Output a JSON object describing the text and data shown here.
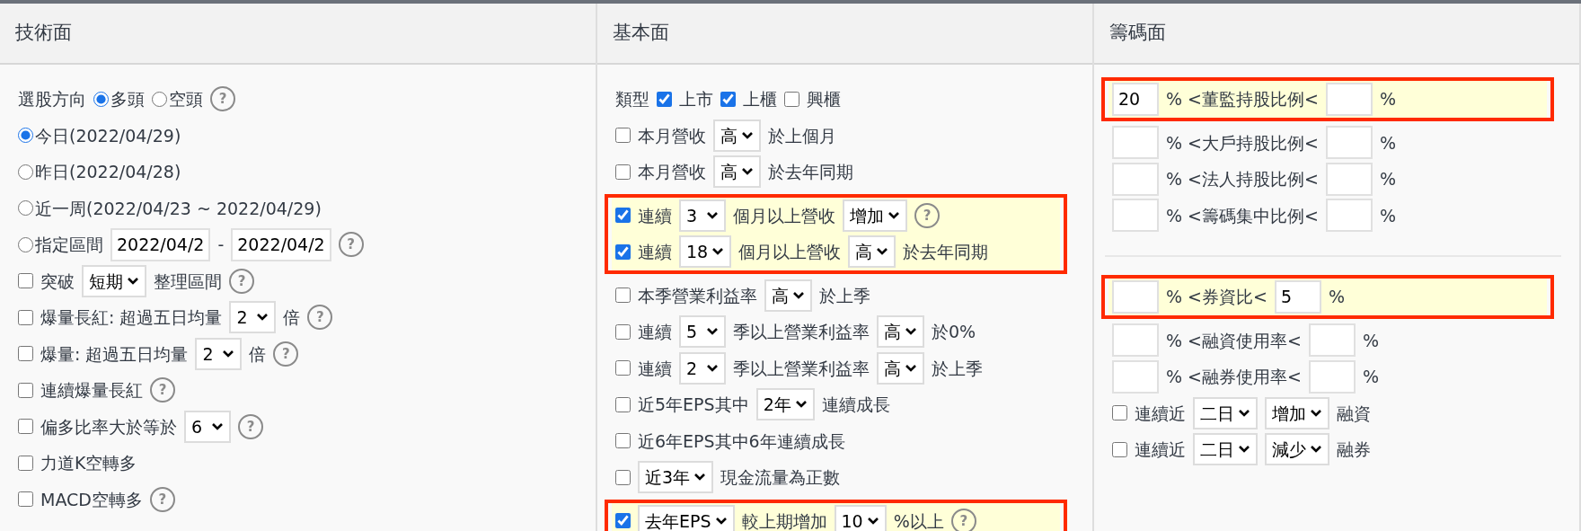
{
  "columns": [
    {
      "title": "技術面",
      "sections": [
        [
          {
            "highlighted": false,
            "rows": [
              {
                "items": [
                  {
                    "kind": "text",
                    "text": "選股方向"
                  },
                  {
                    "kind": "radio",
                    "label": "多頭",
                    "selected": true
                  },
                  {
                    "kind": "radio",
                    "label": "空頭",
                    "selected": false
                  },
                  {
                    "kind": "help",
                    "label": "?"
                  }
                ]
              },
              {
                "items": [
                  {
                    "kind": "radio",
                    "label": "今日(2022/04/29)",
                    "selected": true
                  }
                ]
              },
              {
                "items": [
                  {
                    "kind": "radio",
                    "label": "昨日(2022/04/28)",
                    "selected": false
                  }
                ]
              },
              {
                "items": [
                  {
                    "kind": "radio",
                    "label": "近一周(2022/04/23 ~ 2022/04/29)",
                    "selected": false
                  }
                ]
              },
              {
                "items": [
                  {
                    "kind": "radio",
                    "label": "指定區間",
                    "selected": false
                  },
                  {
                    "kind": "input",
                    "value": "2022/04/2"
                  },
                  {
                    "kind": "text",
                    "text": "-"
                  },
                  {
                    "kind": "input",
                    "value": "2022/04/2"
                  },
                  {
                    "kind": "help",
                    "label": "?"
                  }
                ]
              },
              {
                "items": [
                  {
                    "kind": "checkbox",
                    "checked": false
                  },
                  {
                    "kind": "text",
                    "text": "突破"
                  },
                  {
                    "kind": "select",
                    "value": "短期"
                  },
                  {
                    "kind": "text",
                    "text": "整理區間"
                  },
                  {
                    "kind": "help",
                    "label": "?"
                  }
                ]
              },
              {
                "items": [
                  {
                    "kind": "checkbox",
                    "checked": false
                  },
                  {
                    "kind": "text",
                    "text": "爆量長紅: 超過五日均量"
                  },
                  {
                    "kind": "select",
                    "value": "2"
                  },
                  {
                    "kind": "text",
                    "text": "倍"
                  },
                  {
                    "kind": "help",
                    "label": "?"
                  }
                ]
              },
              {
                "items": [
                  {
                    "kind": "checkbox",
                    "checked": false
                  },
                  {
                    "kind": "text",
                    "text": "爆量: 超過五日均量"
                  },
                  {
                    "kind": "select",
                    "value": "2"
                  },
                  {
                    "kind": "text",
                    "text": "倍"
                  },
                  {
                    "kind": "help",
                    "label": "?"
                  }
                ]
              },
              {
                "items": [
                  {
                    "kind": "checkbox",
                    "checked": false
                  },
                  {
                    "kind": "text",
                    "text": "連續爆量長紅"
                  },
                  {
                    "kind": "help",
                    "label": "?"
                  }
                ]
              },
              {
                "items": [
                  {
                    "kind": "checkbox",
                    "checked": false
                  },
                  {
                    "kind": "text",
                    "text": "偏多比率大於等於"
                  },
                  {
                    "kind": "select",
                    "value": "6"
                  },
                  {
                    "kind": "help",
                    "label": "?"
                  }
                ]
              },
              {
                "items": [
                  {
                    "kind": "checkbox",
                    "checked": false
                  },
                  {
                    "kind": "text",
                    "text": "力道K空轉多"
                  }
                ]
              },
              {
                "items": [
                  {
                    "kind": "checkbox",
                    "checked": false
                  },
                  {
                    "kind": "text",
                    "text": "MACD空轉多"
                  },
                  {
                    "kind": "help",
                    "label": "?"
                  }
                ]
              }
            ]
          }
        ]
      ]
    },
    {
      "title": "基本面",
      "sections": [
        [
          {
            "highlighted": false,
            "rows": [
              {
                "items": [
                  {
                    "kind": "text",
                    "text": "類型"
                  },
                  {
                    "kind": "checkbox",
                    "checked": true
                  },
                  {
                    "kind": "text",
                    "text": "上市"
                  },
                  {
                    "kind": "checkbox",
                    "checked": true
                  },
                  {
                    "kind": "text",
                    "text": "上櫃"
                  },
                  {
                    "kind": "checkbox",
                    "checked": false
                  },
                  {
                    "kind": "text",
                    "text": "興櫃"
                  }
                ]
              },
              {
                "items": [
                  {
                    "kind": "checkbox",
                    "checked": false
                  },
                  {
                    "kind": "text",
                    "text": "本月營收"
                  },
                  {
                    "kind": "select",
                    "value": "高"
                  },
                  {
                    "kind": "text",
                    "text": "於上個月"
                  }
                ]
              },
              {
                "items": [
                  {
                    "kind": "checkbox",
                    "checked": false
                  },
                  {
                    "kind": "text",
                    "text": "本月營收"
                  },
                  {
                    "kind": "select",
                    "value": "高"
                  },
                  {
                    "kind": "text",
                    "text": "於去年同期"
                  }
                ]
              }
            ]
          },
          {
            "highlighted": true,
            "rows": [
              {
                "items": [
                  {
                    "kind": "checkbox",
                    "checked": true
                  },
                  {
                    "kind": "text",
                    "text": "連續"
                  },
                  {
                    "kind": "select",
                    "value": "3"
                  },
                  {
                    "kind": "text",
                    "text": "個月以上營收"
                  },
                  {
                    "kind": "select",
                    "value": "增加"
                  },
                  {
                    "kind": "help",
                    "label": "?"
                  }
                ]
              },
              {
                "items": [
                  {
                    "kind": "checkbox",
                    "checked": true
                  },
                  {
                    "kind": "text",
                    "text": "連續"
                  },
                  {
                    "kind": "select",
                    "value": "18"
                  },
                  {
                    "kind": "text",
                    "text": "個月以上營收"
                  },
                  {
                    "kind": "select",
                    "value": "高"
                  },
                  {
                    "kind": "text",
                    "text": "於去年同期"
                  }
                ]
              }
            ]
          },
          {
            "highlighted": false,
            "rows": [
              {
                "items": [
                  {
                    "kind": "checkbox",
                    "checked": false
                  },
                  {
                    "kind": "text",
                    "text": "本季營業利益率"
                  },
                  {
                    "kind": "select",
                    "value": "高"
                  },
                  {
                    "kind": "text",
                    "text": "於上季"
                  }
                ]
              },
              {
                "items": [
                  {
                    "kind": "checkbox",
                    "checked": false
                  },
                  {
                    "kind": "text",
                    "text": "連續"
                  },
                  {
                    "kind": "select",
                    "value": "5"
                  },
                  {
                    "kind": "text",
                    "text": "季以上營業利益率"
                  },
                  {
                    "kind": "select",
                    "value": "高"
                  },
                  {
                    "kind": "text",
                    "text": "於0%"
                  }
                ]
              },
              {
                "items": [
                  {
                    "kind": "checkbox",
                    "checked": false
                  },
                  {
                    "kind": "text",
                    "text": "連續"
                  },
                  {
                    "kind": "select",
                    "value": "2"
                  },
                  {
                    "kind": "text",
                    "text": "季以上營業利益率"
                  },
                  {
                    "kind": "select",
                    "value": "高"
                  },
                  {
                    "kind": "text",
                    "text": "於上季"
                  }
                ]
              },
              {
                "items": [
                  {
                    "kind": "checkbox",
                    "checked": false
                  },
                  {
                    "kind": "text",
                    "text": "近5年EPS其中"
                  },
                  {
                    "kind": "select",
                    "value": "2年"
                  },
                  {
                    "kind": "text",
                    "text": "連續成長"
                  }
                ]
              },
              {
                "items": [
                  {
                    "kind": "checkbox",
                    "checked": false
                  },
                  {
                    "kind": "text",
                    "text": "近6年EPS其中6年連續成長"
                  }
                ]
              },
              {
                "items": [
                  {
                    "kind": "checkbox",
                    "checked": false
                  },
                  {
                    "kind": "select",
                    "value": "近3年"
                  },
                  {
                    "kind": "text",
                    "text": "現金流量為正數"
                  }
                ]
              }
            ]
          },
          {
            "highlighted": true,
            "rows": [
              {
                "items": [
                  {
                    "kind": "checkbox",
                    "checked": true
                  },
                  {
                    "kind": "select",
                    "value": "去年EPS"
                  },
                  {
                    "kind": "text",
                    "text": "較上期增加"
                  },
                  {
                    "kind": "select",
                    "value": "10"
                  },
                  {
                    "kind": "text",
                    "text": "%以上"
                  },
                  {
                    "kind": "help",
                    "label": "?"
                  }
                ]
              }
            ]
          }
        ]
      ]
    },
    {
      "title": "籌碼面",
      "sections": [
        [
          {
            "highlighted": true,
            "rows": [
              {
                "items": [
                  {
                    "kind": "input",
                    "value": "20"
                  },
                  {
                    "kind": "text",
                    "text": "% <董監持股比例<"
                  },
                  {
                    "kind": "input"
                  },
                  {
                    "kind": "text",
                    "text": "%"
                  }
                ]
              }
            ]
          },
          {
            "highlighted": false,
            "rows": [
              {
                "items": [
                  {
                    "kind": "input"
                  },
                  {
                    "kind": "text",
                    "text": "% <大戶持股比例<"
                  },
                  {
                    "kind": "input"
                  },
                  {
                    "kind": "text",
                    "text": "%"
                  }
                ]
              },
              {
                "items": [
                  {
                    "kind": "input"
                  },
                  {
                    "kind": "text",
                    "text": "% <法人持股比例<"
                  },
                  {
                    "kind": "input"
                  },
                  {
                    "kind": "text",
                    "text": "%"
                  }
                ]
              },
              {
                "items": [
                  {
                    "kind": "input"
                  },
                  {
                    "kind": "text",
                    "text": "% <籌碼集中比例<"
                  },
                  {
                    "kind": "input"
                  },
                  {
                    "kind": "text",
                    "text": "%"
                  }
                ]
              }
            ]
          }
        ],
        [
          {
            "highlighted": true,
            "rows": [
              {
                "items": [
                  {
                    "kind": "input"
                  },
                  {
                    "kind": "text",
                    "text": "% <券資比<"
                  },
                  {
                    "kind": "input",
                    "value": "5"
                  },
                  {
                    "kind": "text",
                    "text": "%"
                  }
                ]
              }
            ]
          },
          {
            "highlighted": false,
            "rows": [
              {
                "items": [
                  {
                    "kind": "input"
                  },
                  {
                    "kind": "text",
                    "text": "% <融資使用率<"
                  },
                  {
                    "kind": "input"
                  },
                  {
                    "kind": "text",
                    "text": "%"
                  }
                ]
              },
              {
                "items": [
                  {
                    "kind": "input"
                  },
                  {
                    "kind": "text",
                    "text": "% <融券使用率<"
                  },
                  {
                    "kind": "input"
                  },
                  {
                    "kind": "text",
                    "text": "%"
                  }
                ]
              },
              {
                "items": [
                  {
                    "kind": "checkbox",
                    "checked": false
                  },
                  {
                    "kind": "text",
                    "text": "連續近"
                  },
                  {
                    "kind": "select",
                    "value": "二日"
                  },
                  {
                    "kind": "select",
                    "value": "增加"
                  },
                  {
                    "kind": "text",
                    "text": "融資"
                  }
                ]
              },
              {
                "items": [
                  {
                    "kind": "checkbox",
                    "checked": false
                  },
                  {
                    "kind": "text",
                    "text": "連續近"
                  },
                  {
                    "kind": "select",
                    "value": "二日"
                  },
                  {
                    "kind": "select",
                    "value": "減少"
                  },
                  {
                    "kind": "text",
                    "text": "融券"
                  }
                ]
              }
            ]
          }
        ]
      ]
    }
  ]
}
